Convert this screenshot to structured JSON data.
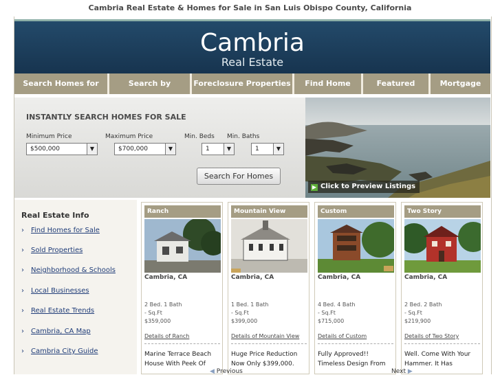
{
  "page_title": "Cambria Real Estate & Homes for Sale in San Luis Obispo County, California",
  "logo": {
    "line1": "Cambria",
    "line2": "Real Estate"
  },
  "nav": [
    "Search Homes for Sale",
    "Search by Keyword",
    "Foreclosure Properties",
    "Find Home Values",
    "Featured Homes",
    "Mortgage Info"
  ],
  "search": {
    "title": "INSTANTLY SEARCH HOMES FOR SALE",
    "min_price_label": "Minimum Price",
    "min_price_value": "$500,000",
    "max_price_label": "Maximum Price",
    "max_price_value": "$700,000",
    "beds_label": "Min. Beds",
    "beds_value": "1",
    "baths_label": "Min. Baths",
    "baths_value": "1",
    "button": "Search For Homes"
  },
  "preview_label": "Click to Preview Listings",
  "sidebar": {
    "title": "Real Estate Info",
    "links": [
      "Find Homes for Sale",
      "Sold Properties",
      "Neighborhood & Schools",
      "Local Businesses",
      "Real Estate Trends",
      "Cambria, CA Map",
      "Cambria City Guide"
    ]
  },
  "listings": [
    {
      "title": "Ranch",
      "location": "Cambria, CA",
      "beds_baths": "2 Bed. 1 Bath",
      "sqft": "- Sq.Ft",
      "price": "$359,000",
      "details": "Details of Ranch",
      "desc1": "Marine Terrace Beach",
      "desc2": "House With Peek Of"
    },
    {
      "title": "Mountain View",
      "location": "Cambria, CA",
      "beds_baths": "1 Bed. 1 Bath",
      "sqft": "- Sq.Ft",
      "price": "$399,000",
      "details": "Details of Mountain View",
      "desc1": "Huge Price Reduction",
      "desc2": "Now Only $399,000."
    },
    {
      "title": "Custom",
      "location": "Cambria, CA",
      "beds_baths": "4 Bed. 4 Bath",
      "sqft": "- Sq.Ft",
      "price": "$715,000",
      "details": "Details of Custom",
      "desc1": "Fully Approved!!",
      "desc2": "Timeless Design From"
    },
    {
      "title": "Two Story",
      "location": "Cambria, CA",
      "beds_baths": "2 Bed. 2 Bath",
      "sqft": "- Sq.Ft",
      "price": "$219,900",
      "details": "Details of Two Story",
      "desc1": "Well. Come With Your",
      "desc2": "Hammer. It Has"
    }
  ],
  "pager": {
    "previous": "Previous",
    "next": "Next"
  }
}
